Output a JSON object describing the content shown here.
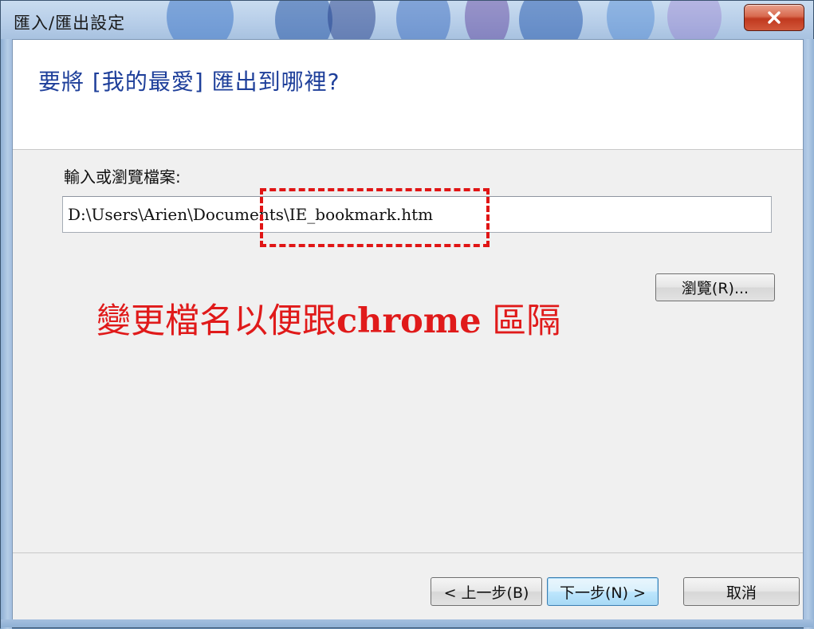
{
  "window": {
    "title": "匯入/匯出設定",
    "close_icon": "close-x-icon"
  },
  "header": {
    "title": "要將 [我的最愛] 匯出到哪裡?"
  },
  "form": {
    "label": "輸入或瀏覽檔案:",
    "path_value": "D:\\Users\\Arien\\Documents\\IE_bookmark.htm",
    "browse_label": "瀏覽(R)..."
  },
  "annotation": {
    "text_before": "變更檔名以便跟",
    "text_bold": "chrome",
    "text_after": " 區隔",
    "color": "#e01a1a"
  },
  "footer": {
    "back_label": "< 上一步(B)",
    "next_label": "下一步(N) >",
    "cancel_label": "取消"
  },
  "colors": {
    "header_title": "#1e3f9a",
    "close_button": "#c0391f",
    "highlight_border": "#e01515"
  }
}
